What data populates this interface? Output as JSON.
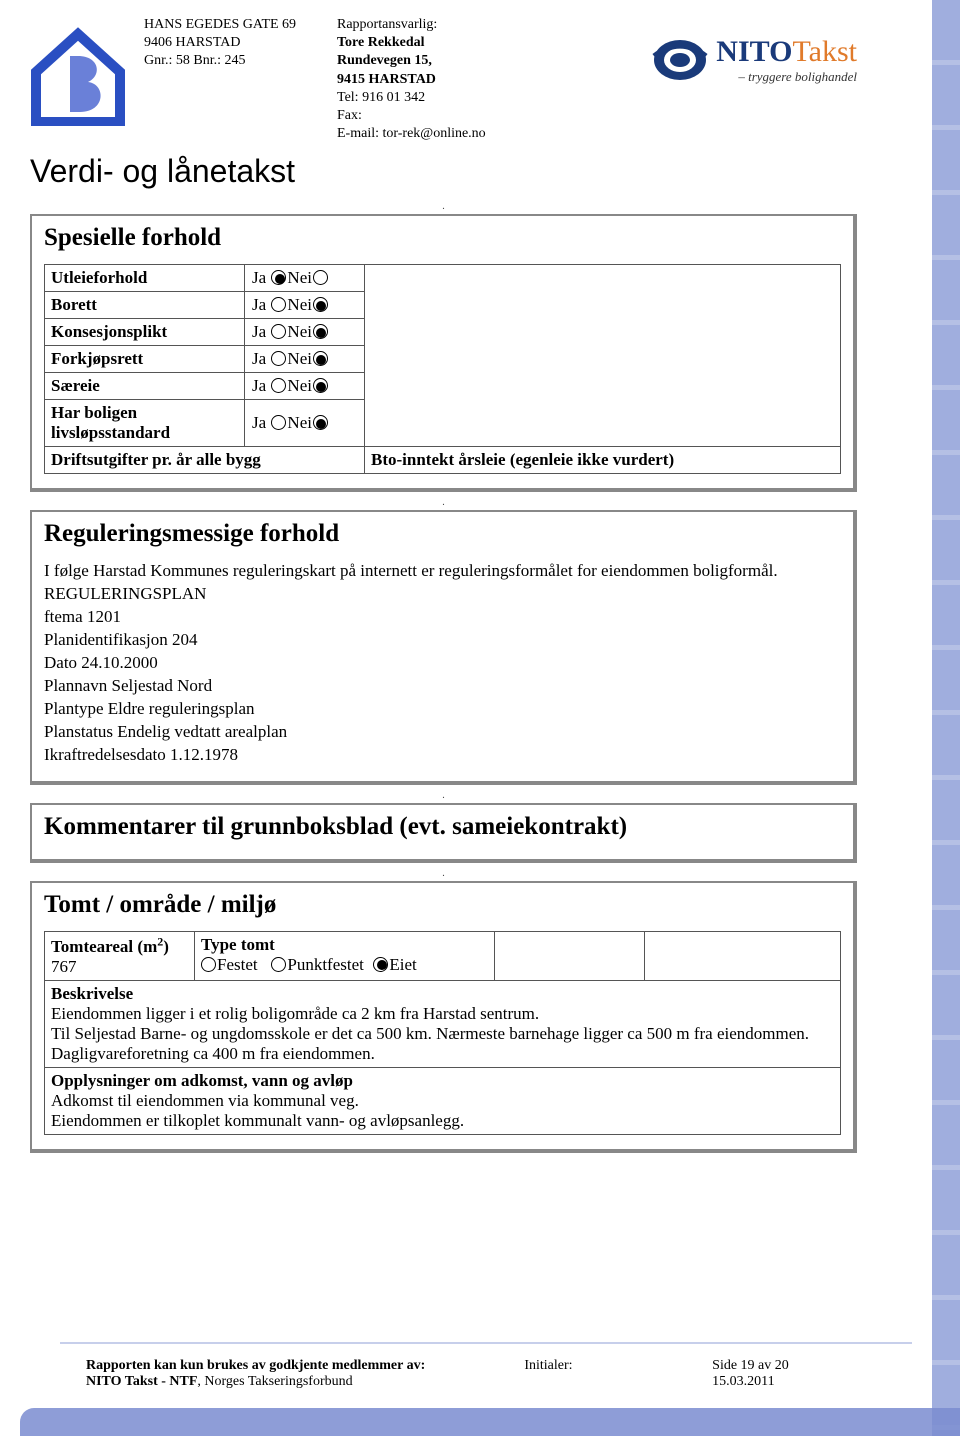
{
  "header": {
    "address": {
      "street": "HANS EGEDES GATE 69",
      "postal": "9406 HARSTAD",
      "gnr_bnr": "Gnr.: 58 Bnr.: 245"
    },
    "responsible": {
      "label": "Rapportansvarlig:",
      "name": "Tore Rekkedal",
      "addr1": "Rundevegen 15,",
      "addr2": "9415 HARSTAD",
      "tel": "Tel: 916 01 342",
      "fax": "Fax:",
      "email": "E-mail: tor-rek@online.no"
    },
    "nito": {
      "brand_main": "NITO",
      "brand_sub": "Takst",
      "tagline": "– tryggere bolighandel"
    }
  },
  "main_title": "Verdi- og lånetakst",
  "spesielle": {
    "title": "Spesielle forhold",
    "rows": {
      "utleie": "Utleieforhold",
      "borett": "Borett",
      "konsesjon": "Konsesjonsplikt",
      "forkjop": "Forkjøpsrett",
      "saereie": "Særeie",
      "livslop": "Har boligen livsløpsstandard",
      "drift_label": "Driftsutgifter pr. år alle bygg",
      "drift_val": "Bto-inntekt årsleie (egenleie ikke vurdert)",
      "ja": "Ja",
      "nei": "Nei"
    }
  },
  "regulering": {
    "title": "Reguleringsmessige forhold",
    "p1": "I følge Harstad Kommunes reguleringskart på internett er reguleringsformålet for eiendommen boligformål.",
    "l1": "REGULERINGSPLAN",
    "l2": "ftema 1201",
    "l3": "Planidentifikasjon 204",
    "l4": "Dato 24.10.2000",
    "l5": "Plannavn Seljestad Nord",
    "l6": "Plantype Eldre reguleringsplan",
    "l7": "Planstatus Endelig vedtatt arealplan",
    "l8": "Ikraftredelsesdato 1.12.1978"
  },
  "kommentar": {
    "title": "Kommentarer til grunnboksblad (evt. sameiekontrakt)"
  },
  "tomt": {
    "title": "Tomt / område / miljø",
    "areal_label": "Tomteareal (m",
    "areal_sup": "2",
    "areal_close": ")",
    "areal_val": "767",
    "type_label": "Type tomt",
    "festet": "Festet",
    "punkt": "Punktfestet",
    "eiet": "Eiet",
    "beskr_label": "Beskrivelse",
    "beskr_1": "Eiendommen ligger i et rolig boligområde ca 2 km fra Harstad sentrum.",
    "beskr_2": "Til Seljestad Barne- og ungdomsskole er det ca 500 km. Nærmeste barnehage ligger ca 500 m fra eiendommen. Dagligvareforetning ca 400 m fra eiendommen.",
    "oppl_label": "Opplysninger om adkomst, vann og avløp",
    "oppl_1": "Adkomst til eiendommen via kommunal veg.",
    "oppl_2": "Eiendommen er tilkoplet kommunalt vann- og avløpsanlegg."
  },
  "footer": {
    "left1": "Rapporten kan kun brukes av godkjente medlemmer av:",
    "left2_b": "NITO Takst - NTF",
    "left2_r": ", Norges Takseringsforbund",
    "mid": "Initialer:",
    "right1": "Side 19 av 20",
    "right2": "15.03.2011"
  }
}
